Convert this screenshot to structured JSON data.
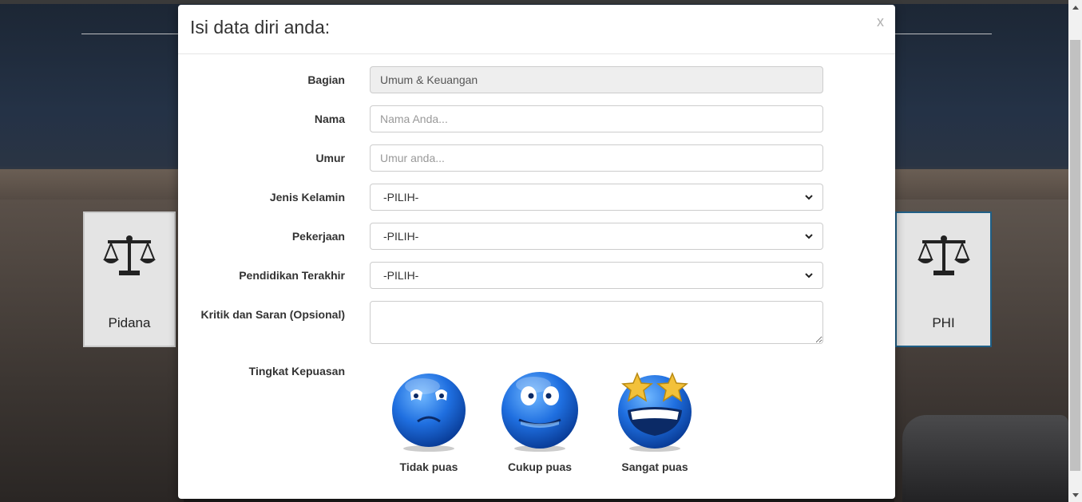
{
  "background": {
    "left_card_title": "Pidana",
    "right_card_title": "PHI"
  },
  "modal": {
    "title": "Isi data diri anda:",
    "close_label": "x",
    "fields": {
      "bagian": {
        "label": "Bagian",
        "value": "Umum & Keuangan"
      },
      "nama": {
        "label": "Nama",
        "placeholder": "Nama Anda..."
      },
      "umur": {
        "label": "Umur",
        "placeholder": "Umur anda..."
      },
      "jenis_kelamin": {
        "label": "Jenis Kelamin",
        "selected": "-PILIH-"
      },
      "pekerjaan": {
        "label": "Pekerjaan",
        "selected": "-PILIH-"
      },
      "pendidikan": {
        "label": "Pendidikan Terakhir",
        "selected": "-PILIH-"
      },
      "kritik": {
        "label": "Kritik dan Saran (Opsional)",
        "placeholder": ""
      }
    },
    "satisfaction": {
      "label": "Tingkat Kepuasan",
      "options": [
        {
          "label": "Tidak puas",
          "icon": "sad-face-icon"
        },
        {
          "label": "Cukup puas",
          "icon": "neutral-face-icon"
        },
        {
          "label": "Sangat puas",
          "icon": "star-eyes-face-icon"
        }
      ]
    }
  },
  "colors": {
    "modal_bg": "#ffffff",
    "emoji_blue": "#1f6fe0",
    "star_gold": "#f3c13a",
    "active_card_border": "#1f5f86"
  }
}
